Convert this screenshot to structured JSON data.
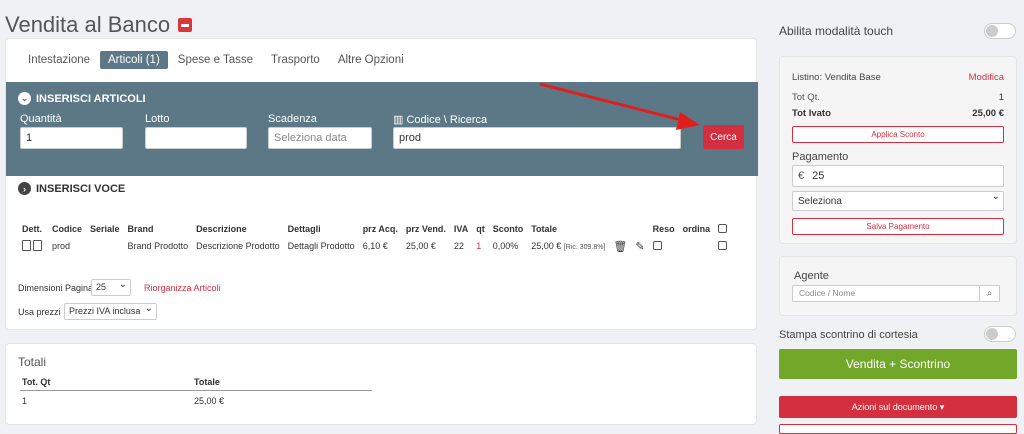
{
  "title": "Vendita al Banco",
  "tabs": [
    "Intestazione",
    "Articoli (1)",
    "Spese e Tasse",
    "Trasporto",
    "Altre Opzioni"
  ],
  "ins_articoli": {
    "header": "INSERISCI ARTICOLI",
    "quantita_label": "Quantità",
    "quantita_value": "1",
    "lotto_label": "Lotto",
    "scadenza_label": "Scadenza",
    "scadenza_placeholder": "Seleziona data",
    "codice_label": "Codice \\ Ricerca",
    "codice_value": "prod",
    "cerca": "Cerca"
  },
  "ins_voce": "INSERISCI VOCE",
  "table": {
    "headers": [
      "Dett.",
      "Codice",
      "Seriale",
      "Brand",
      "Descrizione",
      "Dettagli",
      "prz Acq.",
      "prz Vend.",
      "IVA",
      "qt",
      "Sconto",
      "Totale",
      "",
      "",
      "Reso",
      "ordina"
    ],
    "row": {
      "codice": "prod",
      "seriale": "",
      "brand": "Brand Prodotto",
      "descrizione": "Descrizione Prodotto",
      "dettagli": "Dettagli Prodotto",
      "prz_acq": "6,10 €",
      "prz_vend": "25,00 €",
      "iva": "22",
      "qt": "1",
      "sconto": "0,00%",
      "totale": "25,00 €",
      "ric": "[Ric. 309.8%]"
    }
  },
  "dim_pagina_label": "Dimensioni Pagina",
  "dim_pagina_value": "25",
  "riorganizza": "Riorganizza Articoli",
  "usa_prezzi_label": "Usa prezzi",
  "usa_prezzi_value": "Prezzi IVA inclusa",
  "totali": {
    "title": "Totali",
    "headers": [
      "Tot. Qt",
      "Totale"
    ],
    "values": [
      "1",
      "25,00 €"
    ]
  },
  "sidebar": {
    "touch_label": "Abilita modalità touch",
    "listino_label": "Listino: Vendita Base",
    "modifica": "Modifica",
    "tot_qt_label": "Tot Qt.",
    "tot_qt_value": "1",
    "tot_ivato_label": "Tot Ivato",
    "tot_ivato_value": "25,00 €",
    "applica_sconto": "Applica Sconto",
    "pagamento_label": "Pagamento",
    "currency": "€",
    "pagamento_value": "25",
    "seleziona": "Seleziona",
    "salva_pagamento": "Salva Pagamento",
    "agente_label": "Agente",
    "agente_placeholder": "Codice / Nome",
    "stampa_label": "Stampa scontrino di cortesia",
    "vendita_btn": "Vendita + Scontrino",
    "azioni_btn": "Azioni sul documento ▾"
  },
  "colors": {
    "header_bg": "#5c7887",
    "accent_red": "#d32f3f",
    "green": "#71a82a",
    "arrow": "#e01e1e"
  }
}
